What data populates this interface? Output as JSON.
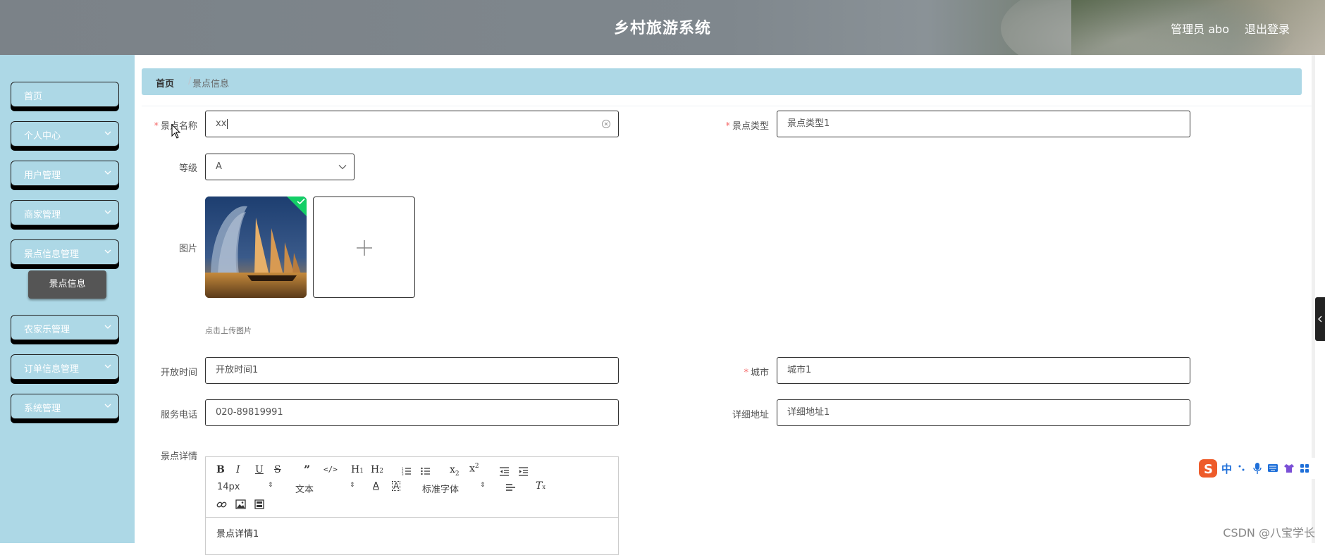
{
  "header": {
    "title": "乡村旅游系统",
    "admin": "管理员 abo",
    "logout": "退出登录"
  },
  "sidebar": {
    "items": [
      {
        "label": "首页",
        "has_arrow": false
      },
      {
        "label": "个人中心",
        "has_arrow": true
      },
      {
        "label": "用户管理",
        "has_arrow": true
      },
      {
        "label": "商家管理",
        "has_arrow": true
      },
      {
        "label": "景点信息管理",
        "has_arrow": true
      },
      {
        "label": "农家乐管理",
        "has_arrow": true
      },
      {
        "label": "订单信息管理",
        "has_arrow": true
      },
      {
        "label": "系统管理",
        "has_arrow": true
      }
    ],
    "submenu_active": "景点信息"
  },
  "breadcrumb": {
    "home": "首页",
    "separator": "/",
    "current": "景点信息"
  },
  "form": {
    "name": {
      "label": "景点名称",
      "value": "xx",
      "required": true
    },
    "type": {
      "label": "景点类型",
      "value": "景点类型1",
      "required": true
    },
    "level": {
      "label": "等级",
      "value": "A"
    },
    "image": {
      "label": "图片",
      "tip": "点击上传图片"
    },
    "open_time": {
      "label": "开放时间",
      "value": "开放时间1"
    },
    "city": {
      "label": "城市",
      "value": "城市1",
      "required": true
    },
    "phone": {
      "label": "服务电话",
      "value": "020-89819991"
    },
    "address": {
      "label": "详细地址",
      "value": "详细地址1"
    },
    "detail": {
      "label": "景点详情",
      "content": "景点详情1"
    }
  },
  "editor": {
    "font_size": "14px",
    "block_type": "文本",
    "font_family": "标准字体"
  },
  "ime": {
    "lang": "中"
  },
  "watermark": "CSDN @八宝学长",
  "colors": {
    "sidebar_bg": "#add8e6",
    "breadcrumb_bg": "#add8e6",
    "required": "#f56c6c",
    "upload_ok": "#13ce66"
  }
}
